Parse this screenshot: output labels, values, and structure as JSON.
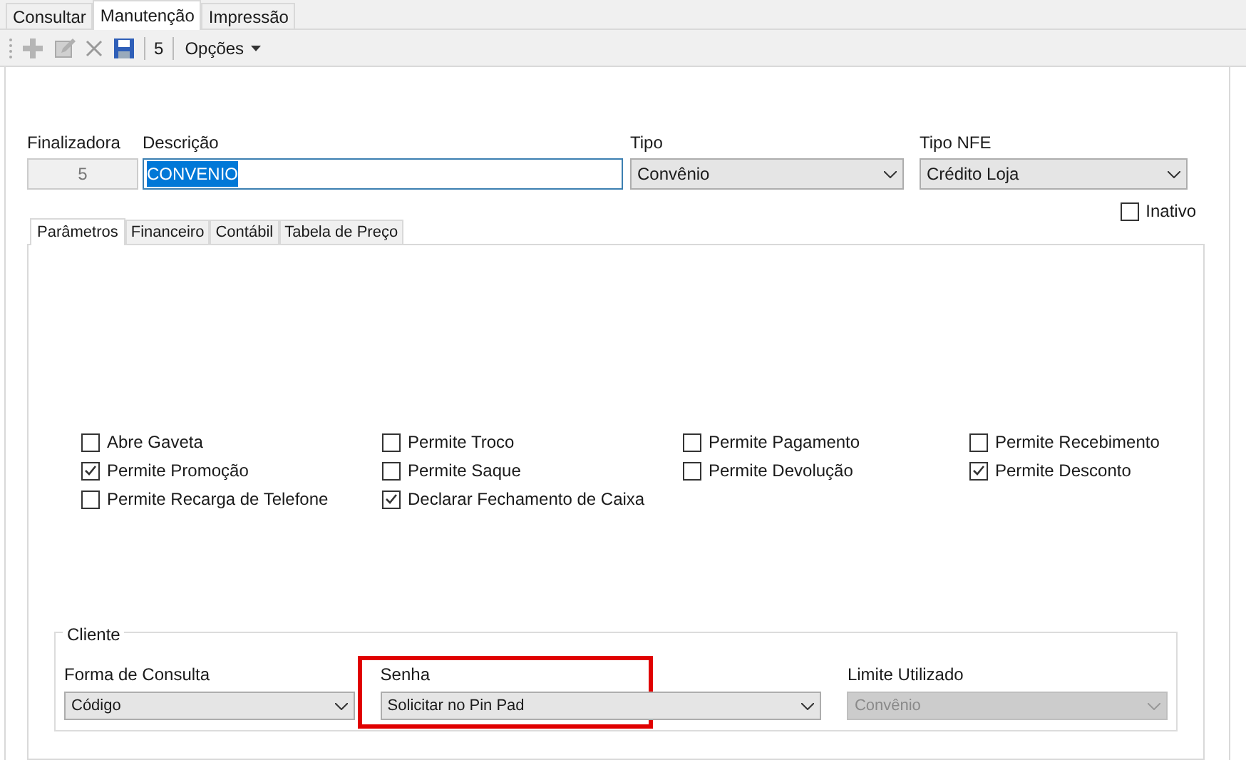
{
  "tabs": [
    {
      "label": "Consultar",
      "selected": false
    },
    {
      "label": "Manutenção",
      "selected": true
    },
    {
      "label": "Impressão",
      "selected": false
    }
  ],
  "toolbar": {
    "record_count": "5",
    "menu": "Opções"
  },
  "header": {
    "finalizadora": {
      "label": "Finalizadora",
      "value": "5"
    },
    "descricao": {
      "label": "Descrição",
      "value": "CONVENIO"
    },
    "tipo": {
      "label": "Tipo",
      "value": "Convênio"
    },
    "tipo_nfe": {
      "label": "Tipo NFE",
      "value": "Crédito Loja"
    },
    "inativo": {
      "label": "Inativo",
      "checked": false
    }
  },
  "inner_tabs": [
    {
      "label": "Parâmetros",
      "selected": true
    },
    {
      "label": "Financeiro",
      "selected": false
    },
    {
      "label": "Contábil",
      "selected": false
    },
    {
      "label": "Tabela de Preço",
      "selected": false
    }
  ],
  "options": [
    {
      "label": "Abre Gaveta",
      "checked": false
    },
    {
      "label": "Permite Troco",
      "checked": false
    },
    {
      "label": "Permite Pagamento",
      "checked": false
    },
    {
      "label": "Permite Recebimento",
      "checked": false
    },
    {
      "label": "Permite Promoção",
      "checked": true
    },
    {
      "label": "Permite Saque",
      "checked": false
    },
    {
      "label": "Permite Devolução",
      "checked": false
    },
    {
      "label": "Permite Desconto",
      "checked": true
    },
    {
      "label": "Permite Recarga de Telefone",
      "checked": false
    },
    {
      "label": "Declarar Fechamento de Caixa",
      "checked": true
    }
  ],
  "cliente": {
    "title": "Cliente",
    "fields": [
      {
        "label": "Forma de Consulta",
        "value": "Código",
        "disabled": false,
        "highlighted": false
      },
      {
        "label": "Senha",
        "value": "Solicitar no Pin Pad",
        "disabled": false,
        "highlighted": true
      },
      {
        "label": "Limite Utilizado",
        "value": "Convênio",
        "disabled": true,
        "highlighted": false
      }
    ]
  }
}
